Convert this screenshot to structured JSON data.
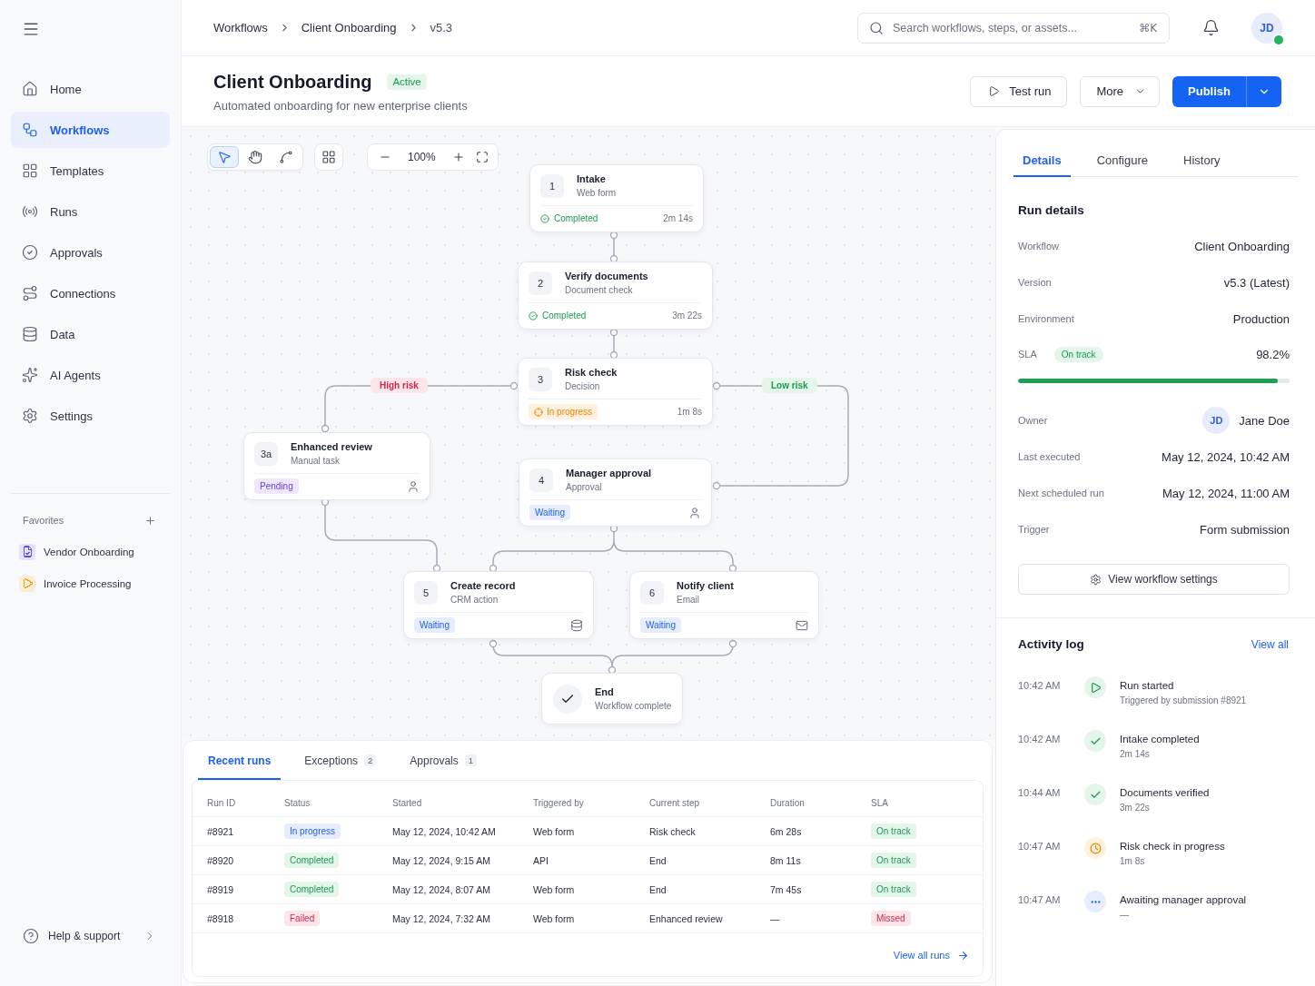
{
  "sidebar": {
    "items": [
      {
        "label": "Home",
        "selected": false
      },
      {
        "label": "Workflows",
        "selected": true
      },
      {
        "label": "Templates",
        "selected": false
      },
      {
        "label": "Runs",
        "selected": false
      },
      {
        "label": "Approvals",
        "selected": false
      },
      {
        "label": "Connections",
        "selected": false
      },
      {
        "label": "Data",
        "selected": false
      },
      {
        "label": "AI Agents",
        "selected": false
      },
      {
        "label": "Settings",
        "selected": false
      }
    ],
    "favorites": {
      "title": "Favorites",
      "items": [
        {
          "label": "Vendor Onboarding",
          "color": "#6d4ae0"
        },
        {
          "label": "Invoice Processing",
          "color": "#f59e0b"
        }
      ]
    },
    "help": "Help & support"
  },
  "breadcrumbs": [
    "Workflows",
    "Client Onboarding",
    "v5.3"
  ],
  "search": {
    "placeholder": "Search workflows, steps, or assets...",
    "shortcut": "⌘K"
  },
  "user": {
    "initials": "JD",
    "online": true
  },
  "header": {
    "title": "Client Onboarding",
    "status": "Active",
    "subtitle": "Automated onboarding for new enterprise clients"
  },
  "actions": [
    {
      "kind": "secondary",
      "label": "Test run"
    },
    {
      "kind": "menu",
      "label": "More"
    },
    {
      "kind": "primary",
      "label": "Publish"
    }
  ],
  "canvas": {
    "tools": [
      {
        "selected": true
      },
      {
        "selected": false
      },
      {
        "selected": false
      }
    ],
    "zoom": "100%",
    "nodes": [
      {
        "kind": "step",
        "step": "1",
        "title": "Intake",
        "subtitle": "Web form",
        "status": {
          "kind": "completed",
          "label": "Completed"
        },
        "duration": "2m 14s"
      },
      {
        "kind": "step",
        "step": "2",
        "title": "Verify documents",
        "subtitle": "Document check",
        "status": {
          "kind": "completed",
          "label": "Completed"
        },
        "duration": "3m 22s"
      },
      {
        "kind": "step",
        "step": "3",
        "title": "Risk check",
        "subtitle": "Decision",
        "status": {
          "kind": "in_progress",
          "label": "In progress"
        },
        "duration": "1m 8s"
      },
      {
        "kind": "step",
        "step": "3a",
        "title": "Enhanced review",
        "subtitle": "Manual task",
        "status": {
          "kind": "pending",
          "label": "Pending"
        }
      },
      {
        "kind": "step",
        "step": "4",
        "title": "Manager approval",
        "subtitle": "Approval",
        "status": {
          "kind": "waiting",
          "label": "Waiting"
        }
      },
      {
        "kind": "step",
        "step": "5",
        "title": "Create record",
        "subtitle": "CRM action",
        "status": {
          "kind": "waiting",
          "label": "Waiting"
        }
      },
      {
        "kind": "step",
        "step": "6",
        "title": "Notify client",
        "subtitle": "Email",
        "status": {
          "kind": "waiting",
          "label": "Waiting"
        }
      },
      {
        "kind": "end",
        "title": "End",
        "subtitle": "Workflow complete"
      }
    ],
    "branch_labels": [
      {
        "kind": "danger",
        "label": "High risk"
      },
      {
        "kind": "success",
        "label": "Low risk"
      }
    ]
  },
  "runs_panel": {
    "tabs": [
      {
        "label": "Recent runs",
        "selected": true
      },
      {
        "label": "Exceptions",
        "count": "2",
        "selected": false
      },
      {
        "label": "Approvals",
        "count": "1",
        "selected": false
      }
    ],
    "columns": [
      "Run ID",
      "Status",
      "Started",
      "Triggered by",
      "Current step",
      "Duration",
      "SLA"
    ],
    "rows": [
      {
        "run_id": "#8921",
        "status": {
          "kind": "in_progress",
          "label": "In progress"
        },
        "started": "May 12, 2024, 10:42 AM",
        "triggered_by": "Web form",
        "current_step": "Risk check",
        "duration": "6m 28s",
        "sla": {
          "kind": "on_track",
          "label": "On track"
        }
      },
      {
        "run_id": "#8920",
        "status": {
          "kind": "completed",
          "label": "Completed"
        },
        "started": "May 12, 2024, 9:15 AM",
        "triggered_by": "API",
        "current_step": "End",
        "duration": "8m 11s",
        "sla": {
          "kind": "on_track",
          "label": "On track"
        }
      },
      {
        "run_id": "#8919",
        "status": {
          "kind": "completed",
          "label": "Completed"
        },
        "started": "May 12, 2024, 8:07 AM",
        "triggered_by": "Web form",
        "current_step": "End",
        "duration": "7m 45s",
        "sla": {
          "kind": "on_track",
          "label": "On track"
        }
      },
      {
        "run_id": "#8918",
        "status": {
          "kind": "failed",
          "label": "Failed"
        },
        "started": "May 12, 2024, 7:32 AM",
        "triggered_by": "Web form",
        "current_step": "Enhanced review",
        "duration": "—",
        "sla": {
          "kind": "missed",
          "label": "Missed"
        }
      }
    ],
    "link": "View all runs"
  },
  "details_panel": {
    "tabs": [
      {
        "label": "Details",
        "selected": true
      },
      {
        "label": "Configure",
        "selected": false
      },
      {
        "label": "History",
        "selected": false
      }
    ],
    "title": "Run details",
    "fields": [
      {
        "kind": "text",
        "label": "Workflow",
        "value": "Client Onboarding"
      },
      {
        "kind": "text",
        "label": "Version",
        "value": "v5.3 (Latest)"
      },
      {
        "kind": "text",
        "label": "Environment",
        "value": "Production"
      },
      {
        "kind": "meter",
        "label": "SLA",
        "badge": "On track",
        "value": "98.2%",
        "level": 0.955
      },
      {
        "kind": "person",
        "label": "Owner",
        "initials": "JD",
        "value": "Jane Doe"
      },
      {
        "kind": "text",
        "label": "Last executed",
        "value": "May 12, 2024, 10:42 AM"
      },
      {
        "kind": "text",
        "label": "Next scheduled run",
        "value": "May 12, 2024, 11:00 AM"
      },
      {
        "kind": "text",
        "label": "Trigger",
        "value": "Form submission"
      }
    ],
    "settings_button": "View workflow settings"
  },
  "activity_log": {
    "title": "Activity log",
    "link": "View all",
    "entries": [
      {
        "kind": "started",
        "time": "10:42 AM",
        "title": "Run started",
        "detail": "Triggered by submission #8921"
      },
      {
        "kind": "completed",
        "time": "10:42 AM",
        "title": "Intake completed",
        "detail": "2m 14s"
      },
      {
        "kind": "completed",
        "time": "10:44 AM",
        "title": "Documents verified",
        "detail": "3m 22s"
      },
      {
        "kind": "in_progress",
        "time": "10:47 AM",
        "title": "Risk check in progress",
        "detail": "1m 8s"
      },
      {
        "kind": "waiting",
        "time": "10:47 AM",
        "title": "Awaiting manager approval",
        "detail": "—"
      }
    ]
  }
}
